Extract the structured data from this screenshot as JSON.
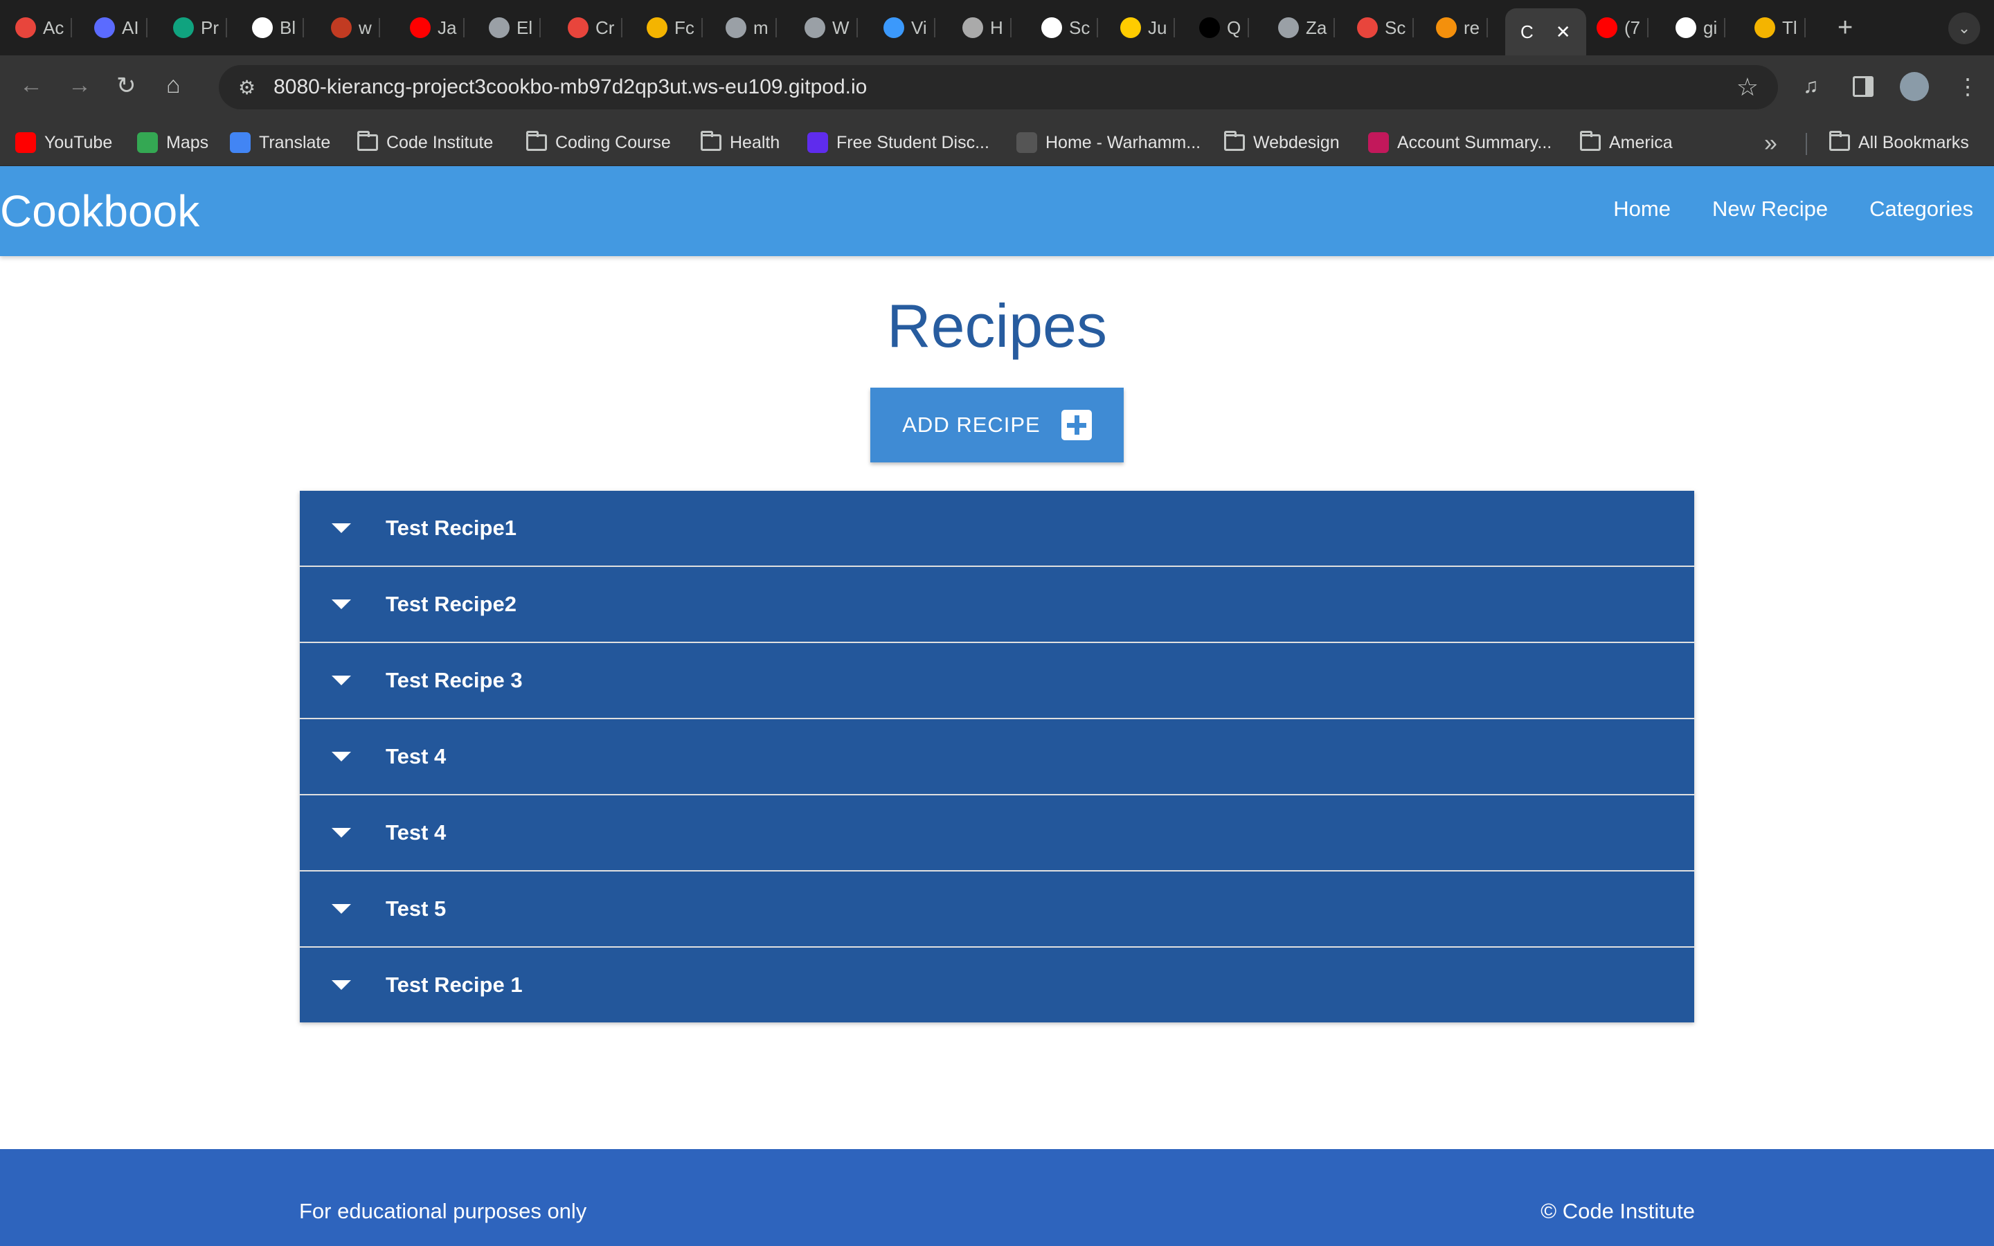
{
  "browser": {
    "tabs": [
      {
        "label": "Ac",
        "color": "#e8453c"
      },
      {
        "label": "AI",
        "color": "#5b6bff"
      },
      {
        "label": "Pr",
        "color": "#10a37f"
      },
      {
        "label": "Bl",
        "color": "#ffffff"
      },
      {
        "label": "w",
        "color": "#c23b22"
      },
      {
        "label": "Ja",
        "color": "#ff0000"
      },
      {
        "label": "El",
        "color": "#9aa0a6"
      },
      {
        "label": "Cr",
        "color": "#e8453c"
      },
      {
        "label": "Fc",
        "color": "#f4b400"
      },
      {
        "label": "m",
        "color": "#9aa0a6"
      },
      {
        "label": "W",
        "color": "#9aa0a6"
      },
      {
        "label": "Vi",
        "color": "#3b99fc"
      },
      {
        "label": "H",
        "color": "#aaaaaa"
      },
      {
        "label": "Sc",
        "color": "#ffffff"
      },
      {
        "label": "Ju",
        "color": "#ffcc00"
      },
      {
        "label": "Q",
        "color": "#000000"
      },
      {
        "label": "Za",
        "color": "#9aa0a6"
      },
      {
        "label": "Sc",
        "color": "#e8453c"
      },
      {
        "label": "re",
        "color": "#f4900c"
      },
      {
        "label": "C",
        "color": "#ffffff"
      },
      {
        "label": "(7",
        "color": "#ff0000"
      },
      {
        "label": "gi",
        "color": "#ffffff"
      },
      {
        "label": "Tl",
        "color": "#f4b400"
      }
    ],
    "new_tab": "+",
    "close_tab": "✕",
    "url": "8080-kierancg-project3cookbo-mb97d2qp3ut.ws-eu109.gitpod.io",
    "bookmarks": [
      {
        "label": "YouTube",
        "type": "site",
        "color": "#ff0000"
      },
      {
        "label": "Maps",
        "type": "site",
        "color": "#34a853"
      },
      {
        "label": "Translate",
        "type": "site",
        "color": "#4285f4"
      },
      {
        "label": "Code Institute",
        "type": "folder"
      },
      {
        "label": "Coding Course",
        "type": "folder"
      },
      {
        "label": "Health",
        "type": "folder"
      },
      {
        "label": "Free Student Disc...",
        "type": "site",
        "color": "#5f2ced"
      },
      {
        "label": "Home - Warhamm...",
        "type": "site",
        "color": "#555555"
      },
      {
        "label": "Webdesign",
        "type": "folder"
      },
      {
        "label": "Account Summary...",
        "type": "site",
        "color": "#c2185b"
      },
      {
        "label": "America",
        "type": "folder"
      }
    ],
    "all_bookmarks": "All Bookmarks",
    "overflow": "»"
  },
  "app": {
    "brand": "Cookbook",
    "nav": {
      "home": "Home",
      "new_recipe": "New Recipe",
      "categories": "Categories"
    },
    "title": "Recipes",
    "add_button": "ADD RECIPE",
    "recipes": [
      "Test Recipe1",
      "Test Recipe2",
      "Test Recipe 3",
      "Test 4",
      "Test 4",
      "Test 5",
      "Test Recipe 1"
    ],
    "footer": {
      "left": "For educational purposes only",
      "right": "© Code Institute"
    }
  },
  "colors": {
    "navbar": "#4399e1",
    "accent": "#275c9f",
    "collapsible": "#23579b",
    "footer": "#2e64bd",
    "button": "#3f8bd4"
  }
}
